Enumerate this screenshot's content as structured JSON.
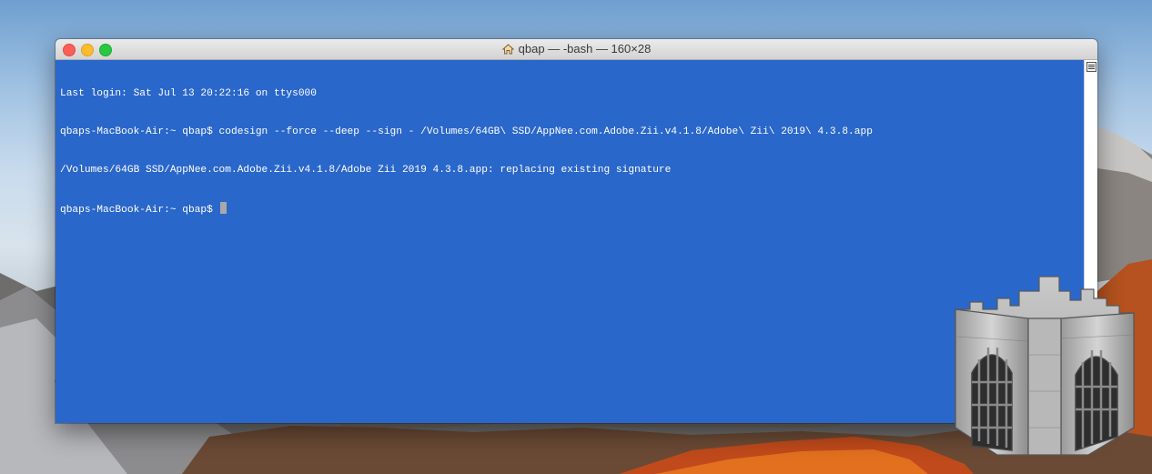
{
  "window": {
    "title": "qbap — -bash — 160×28"
  },
  "terminal": {
    "lines": [
      "Last login: Sat Jul 13 20:22:16 on ttys000",
      "qbaps-MacBook-Air:~ qbap$ codesign --force --deep --sign - /Volumes/64GB\\ SSD/AppNee.com.Adobe.Zii.v4.1.8/Adobe\\ Zii\\ 2019\\ 4.3.8.app",
      "/Volumes/64GB SSD/AppNee.com.Adobe.Zii.v4.1.8/Adobe Zii 2019 4.3.8.app: replacing existing signature",
      "qbaps-MacBook-Air:~ qbap$ "
    ],
    "background_color": "#2a67cb",
    "text_color": "#ffffff"
  },
  "icons": {
    "title_icon": "home-icon",
    "overlay_icon": "gatekeeper-castle-icon"
  }
}
